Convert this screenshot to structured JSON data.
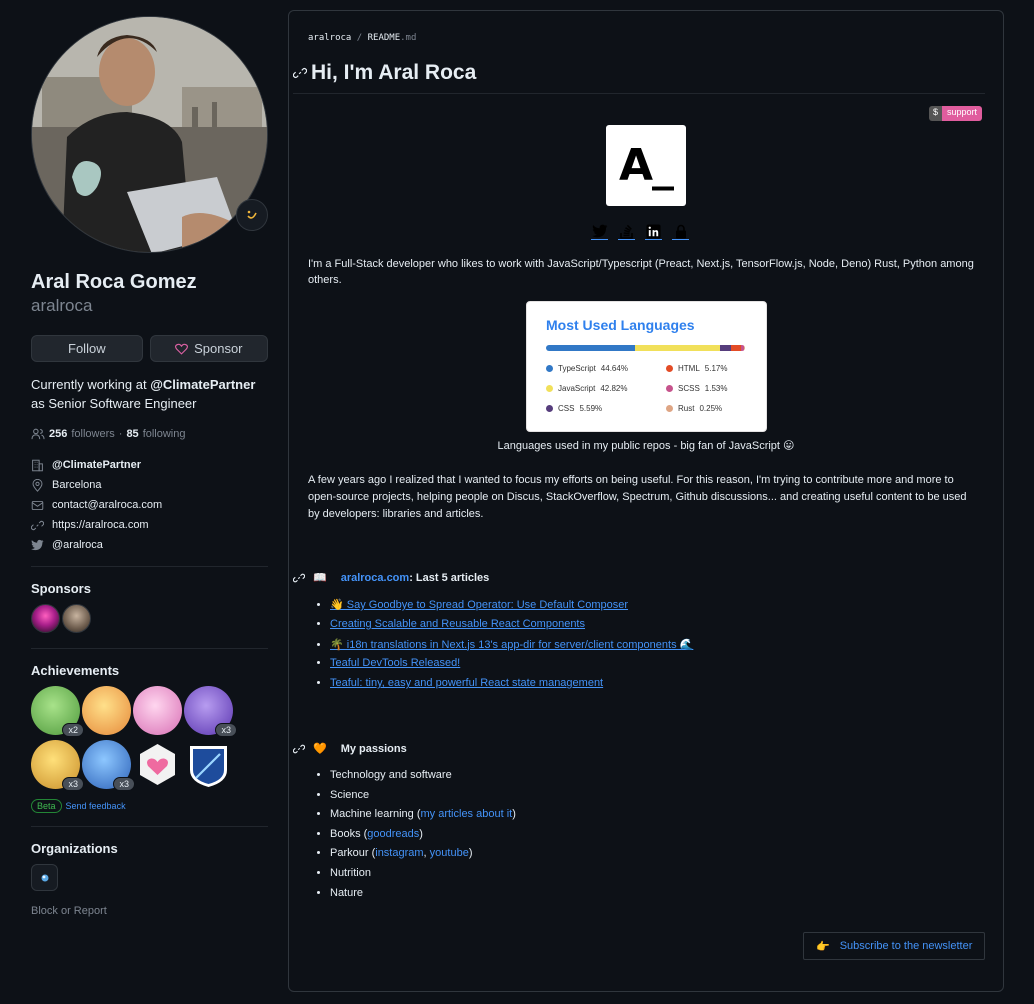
{
  "profile": {
    "fullname": "Aral Roca Gomez",
    "username": "aralroca",
    "follow_label": "Follow",
    "sponsor_label": "Sponsor",
    "bio_prefix": "Currently working at ",
    "bio_company": "@ClimatePartner",
    "bio_suffix": " as Senior Software Engineer",
    "followers_count": "256",
    "followers_label": "followers",
    "dot": "·",
    "following_count": "85",
    "following_label": "following",
    "company": "@ClimatePartner",
    "location": "Barcelona",
    "email": "contact@aralroca.com",
    "website": "https://aralroca.com",
    "twitter": "@aralroca"
  },
  "sponsors": {
    "title": "Sponsors"
  },
  "achievements": {
    "title": "Achievements",
    "items": [
      {
        "name": "pair-extraordinaire",
        "badge": "x2",
        "color": "#7bc86c"
      },
      {
        "name": "quickdraw",
        "badge": "",
        "color": "#f0a04b"
      },
      {
        "name": "yolo",
        "badge": "",
        "color": "#e986c5"
      },
      {
        "name": "starstruck",
        "badge": "x3",
        "color": "#7b52c9"
      },
      {
        "name": "pull-shark-2",
        "badge": "x3",
        "color": "#f5c842"
      },
      {
        "name": "pull-shark",
        "badge": "x3",
        "color": "#3a7bd5"
      },
      {
        "name": "public-sponsor",
        "badge": "",
        "color": "#f7c6d6"
      },
      {
        "name": "arctic-code-vault",
        "badge": "",
        "color": "#1f4a9c"
      }
    ],
    "beta_label": "Beta",
    "feedback_label": "Send feedback"
  },
  "organizations": {
    "title": "Organizations"
  },
  "block_label": "Block or Report",
  "readme": {
    "crumb_user": "aralroca",
    "crumb_sep": "/",
    "crumb_file": "README",
    "crumb_ext": ".md",
    "title": "Hi, I'm Aral Roca",
    "badge_left": "$",
    "badge_right": "support",
    "logo_text": "A_",
    "intro": "I'm a Full-Stack developer who likes to work with JavaScript/Typescript (Preact, Next.js, TensorFlow.js, Node, Deno) Rust, Python among others.",
    "caption": "Languages used in my public repos - big fan of JavaScript 😛",
    "paragraph": "A few years ago I realized that I wanted to focus my efforts on being useful. For this reason, I'm trying to contribute more and more to open-source projects, helping people on Discus, StackOverflow, Spectrum, Github discussions... and creating useful content to be used by developers: libraries and articles.",
    "articles_icon": "📖",
    "articles_link": "aralroca.com",
    "articles_suffix": ": Last 5 articles",
    "articles": [
      "👋 Say Goodbye to Spread Operator: Use Default Composer",
      "Creating Scalable and Reusable React Components",
      "🌴 i18n translations in Next.js 13's app-dir for server/client components 🌊",
      "Teaful DevTools Released!",
      "Teaful: tiny, easy and powerful React state management"
    ],
    "passions_icon": "🧡",
    "passions_title": "My passions",
    "passions": {
      "p1": "Technology and software",
      "p2": "Science",
      "p3_text": "Machine learning (",
      "p3_link": "my articles about it",
      "p3_end": ")",
      "p4_text": "Books (",
      "p4_link": "goodreads",
      "p4_end": ")",
      "p5_text": "Parkour (",
      "p5_link1": "instagram",
      "p5_sep": ", ",
      "p5_link2": "youtube",
      "p5_end": ")",
      "p6": "Nutrition",
      "p7": "Nature"
    },
    "newsletter_icon": "👉",
    "newsletter_label": "Subscribe to the newsletter"
  },
  "languages_card": {
    "title": "Most Used Languages",
    "items": [
      {
        "name": "TypeScript",
        "pct": "44.64%",
        "value": 44.64,
        "color": "#3178c6"
      },
      {
        "name": "HTML",
        "pct": "5.17%",
        "value": 5.17,
        "color": "#e34c26"
      },
      {
        "name": "JavaScript",
        "pct": "42.82%",
        "value": 42.82,
        "color": "#f1e05a"
      },
      {
        "name": "SCSS",
        "pct": "1.53%",
        "value": 1.53,
        "color": "#c6538c"
      },
      {
        "name": "CSS",
        "pct": "5.59%",
        "value": 5.59,
        "color": "#563d7c"
      },
      {
        "name": "Rust",
        "pct": "0.25%",
        "value": 0.25,
        "color": "#dea584"
      }
    ],
    "bar_order": [
      {
        "value": 44.64,
        "color": "#3178c6"
      },
      {
        "value": 42.82,
        "color": "#f1e05a"
      },
      {
        "value": 5.59,
        "color": "#563d7c"
      },
      {
        "value": 5.17,
        "color": "#e34c26"
      },
      {
        "value": 1.53,
        "color": "#c6538c"
      },
      {
        "value": 0.25,
        "color": "#dea584"
      }
    ]
  }
}
